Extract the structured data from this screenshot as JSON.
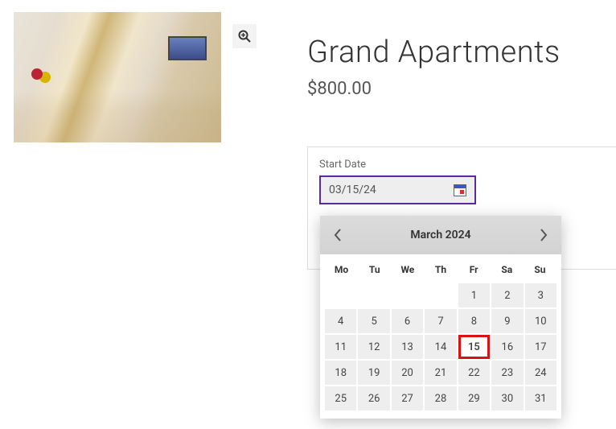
{
  "product": {
    "title": "Grand Apartments",
    "price": "$800.00"
  },
  "booking": {
    "start_date_label": "Start Date",
    "start_date_value": "03/15/24"
  },
  "datepicker": {
    "month_label": "March 2024",
    "weekdays": [
      "Mo",
      "Tu",
      "We",
      "Th",
      "Fr",
      "Sa",
      "Su"
    ],
    "leading_blanks": 4,
    "days": [
      1,
      2,
      3,
      4,
      5,
      6,
      7,
      8,
      9,
      10,
      11,
      12,
      13,
      14,
      15,
      16,
      17,
      18,
      19,
      20,
      21,
      22,
      23,
      24,
      25,
      26,
      27,
      28,
      29,
      30,
      31
    ],
    "selected_day": 15
  },
  "icons": {
    "zoom": "zoom-icon",
    "calendar": "calendar-icon",
    "prev": "chevron-left-icon",
    "next": "chevron-right-icon"
  }
}
